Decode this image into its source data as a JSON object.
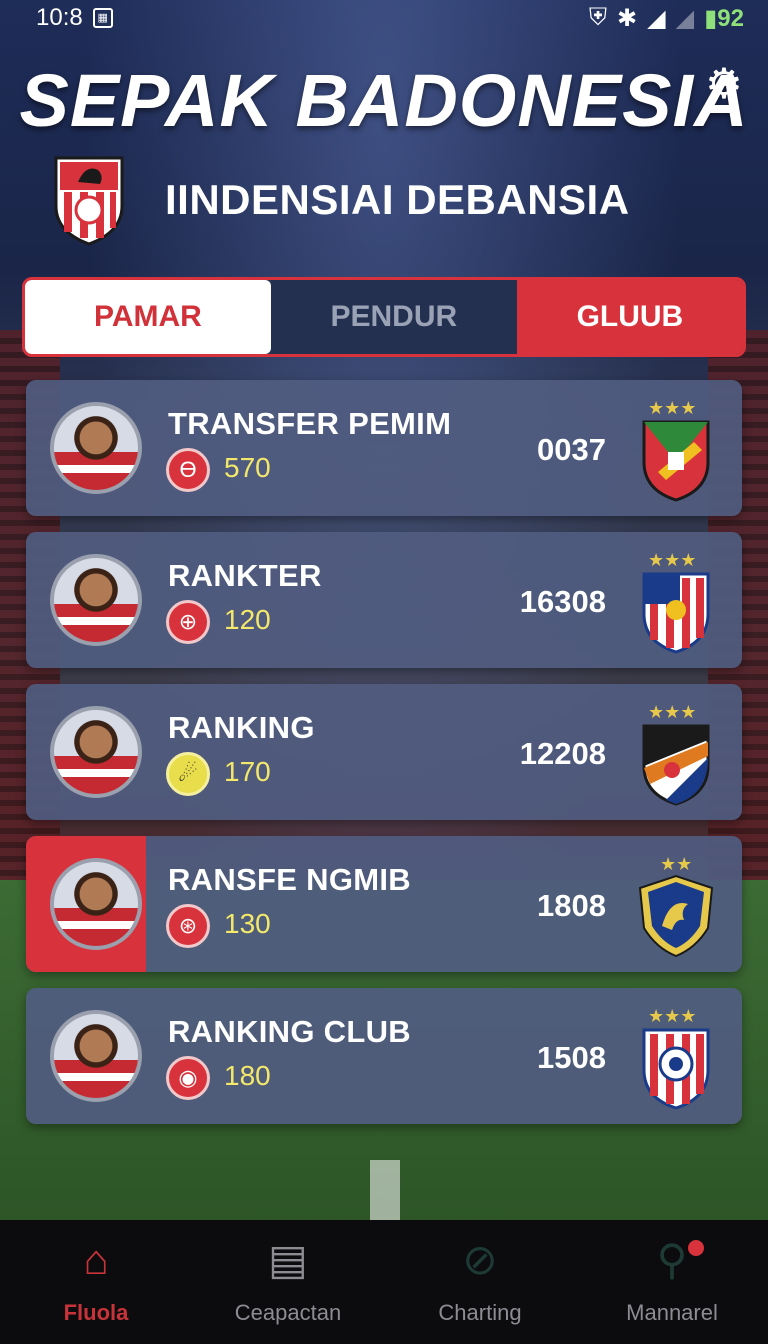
{
  "status_bar": {
    "time": "10:8",
    "battery": "92"
  },
  "header": {
    "title": "SEPAK BADONESIA",
    "subtitle": "IINDENSIAI DEBANSIA"
  },
  "tabs": [
    {
      "label": "PAMAR",
      "active": true
    },
    {
      "label": "PENDUR",
      "active": false
    },
    {
      "label": "GLUUB",
      "active": false
    }
  ],
  "rows": [
    {
      "title": "TRANSFER PEMIM",
      "points": "570",
      "score": "0037",
      "badge_glyph": "Ɵ",
      "crest_stars": 3
    },
    {
      "title": "RANKTER",
      "points": "120",
      "score": "16308",
      "badge_glyph": "⊕",
      "crest_stars": 3
    },
    {
      "title": "RANKING",
      "points": "170",
      "score": "12208",
      "badge_glyph": "☄",
      "crest_stars": 3
    },
    {
      "title": "RANSFE NGMIB",
      "points": "130",
      "score": "1808",
      "badge_glyph": "⊛",
      "crest_stars": 2
    },
    {
      "title": "RANKING CLUB",
      "points": "180",
      "score": "1508",
      "badge_glyph": "◉",
      "crest_stars": 3
    }
  ],
  "bottom_nav": [
    {
      "label": "Fluola",
      "icon": "home-icon"
    },
    {
      "label": "Ceapactan",
      "icon": "document-icon"
    },
    {
      "label": "Charting",
      "icon": "chart-icon"
    },
    {
      "label": "Mannarel",
      "icon": "search-icon"
    }
  ],
  "colors": {
    "accent_red": "#d8333c",
    "points_yellow": "#f3e86a",
    "card_bg": "#505c80",
    "nav_bg": "#0c0c0e"
  }
}
